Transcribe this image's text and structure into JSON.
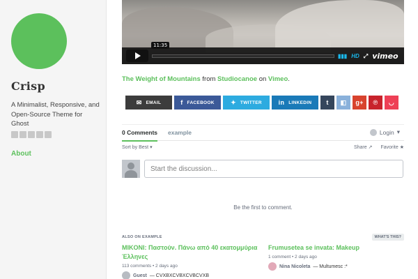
{
  "sidebar": {
    "title": "Crisp",
    "description": "A Minimalist, Responsive, and Open-Source Theme for Ghost",
    "about_label": "About",
    "social_icons": [
      "facebook-icon",
      "twitter-icon",
      "linkedin-icon",
      "email-icon",
      "rss-icon"
    ]
  },
  "video": {
    "timecode": "11:35",
    "hd_label": "HD",
    "vimeo_label": "vimeo"
  },
  "caption": {
    "title": "The Weight of Mountains",
    "from": " from ",
    "author": "Studiocanoe",
    "on": " on ",
    "site": "Vimeo",
    "end": "."
  },
  "share": {
    "email": "EMAIL",
    "facebook": "FACEBOOK",
    "twitter": "TWITTER",
    "linkedin": "LINKEDIN"
  },
  "disqus": {
    "comments_tab": "0 Comments",
    "site_tab": "example",
    "login": "Login",
    "sort": "Sort by Best",
    "share": "Share",
    "favorite": "Favorite",
    "input_placeholder": "Start the discussion...",
    "empty": "Be the first to comment.",
    "also_on_prefix": "ALSO ON ",
    "also_on_site": "EXAMPLE",
    "whats_this": "WHAT'S THIS?",
    "recommendations": [
      {
        "title": "MIKONI: Παστούν. Πάνω από 40 εκατομμύρια Έλληνες",
        "meta": "113 comments • 2 days ago",
        "user": "Guest",
        "excerpt": " — CVXBXCVBXCVBCVXB"
      },
      {
        "title": "Frumusetea se invata: Makeup",
        "meta": "1 comment • 2 days ago",
        "user": "Nina Nicoleta",
        "excerpt": " — Multumesc :*"
      }
    ]
  },
  "colors": {
    "accent": "#5cc05c",
    "facebook": "#3b5998",
    "twitter": "#2dabe0",
    "linkedin": "#1a7ab8"
  }
}
